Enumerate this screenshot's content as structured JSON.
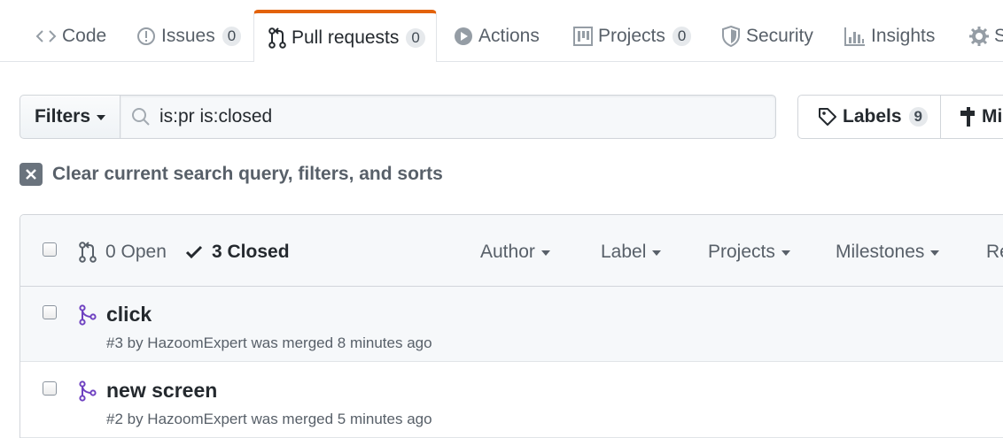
{
  "tabs": [
    {
      "label": "Code",
      "icon": "code-icon"
    },
    {
      "label": "Issues",
      "count": "0",
      "icon": "issue-icon"
    },
    {
      "label": "Pull requests",
      "count": "0",
      "icon": "pull-request-icon",
      "selected": true
    },
    {
      "label": "Actions",
      "icon": "play-icon"
    },
    {
      "label": "Projects",
      "count": "0",
      "icon": "project-icon"
    },
    {
      "label": "Security",
      "icon": "shield-icon"
    },
    {
      "label": "Insights",
      "icon": "graph-icon"
    },
    {
      "label": "S",
      "icon": "gear-icon"
    }
  ],
  "filters": {
    "button_label": "Filters",
    "search_value": "is:pr is:closed",
    "labels_label": "Labels",
    "labels_count": "9",
    "milestones_label": "Mi"
  },
  "clear_query": {
    "label": "Clear current search query, filters, and sorts"
  },
  "list_header": {
    "open_label": "0 Open",
    "closed_label": "3 Closed",
    "sorts": [
      "Author",
      "Label",
      "Projects",
      "Milestones",
      "Re"
    ]
  },
  "pull_requests": [
    {
      "title": "click",
      "meta": "#3 by HazoomExpert was merged 8 minutes ago"
    },
    {
      "title": "new screen",
      "meta": "#2 by HazoomExpert was merged 5 minutes ago"
    }
  ],
  "colors": {
    "accent": "#e36209",
    "merged": "#6f42c1",
    "muted": "#586069"
  }
}
